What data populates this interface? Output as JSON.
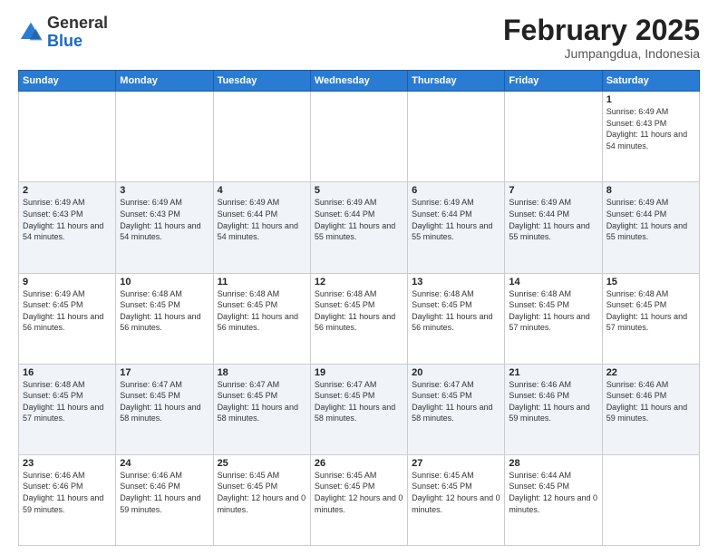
{
  "logo": {
    "general": "General",
    "blue": "Blue"
  },
  "title": {
    "month_year": "February 2025",
    "location": "Jumpangdua, Indonesia"
  },
  "weekdays": [
    "Sunday",
    "Monday",
    "Tuesday",
    "Wednesday",
    "Thursday",
    "Friday",
    "Saturday"
  ],
  "weeks": [
    [
      {
        "day": "",
        "info": ""
      },
      {
        "day": "",
        "info": ""
      },
      {
        "day": "",
        "info": ""
      },
      {
        "day": "",
        "info": ""
      },
      {
        "day": "",
        "info": ""
      },
      {
        "day": "",
        "info": ""
      },
      {
        "day": "1",
        "info": "Sunrise: 6:49 AM\nSunset: 6:43 PM\nDaylight: 11 hours\nand 54 minutes."
      }
    ],
    [
      {
        "day": "2",
        "info": "Sunrise: 6:49 AM\nSunset: 6:43 PM\nDaylight: 11 hours\nand 54 minutes."
      },
      {
        "day": "3",
        "info": "Sunrise: 6:49 AM\nSunset: 6:43 PM\nDaylight: 11 hours\nand 54 minutes."
      },
      {
        "day": "4",
        "info": "Sunrise: 6:49 AM\nSunset: 6:44 PM\nDaylight: 11 hours\nand 54 minutes."
      },
      {
        "day": "5",
        "info": "Sunrise: 6:49 AM\nSunset: 6:44 PM\nDaylight: 11 hours\nand 55 minutes."
      },
      {
        "day": "6",
        "info": "Sunrise: 6:49 AM\nSunset: 6:44 PM\nDaylight: 11 hours\nand 55 minutes."
      },
      {
        "day": "7",
        "info": "Sunrise: 6:49 AM\nSunset: 6:44 PM\nDaylight: 11 hours\nand 55 minutes."
      },
      {
        "day": "8",
        "info": "Sunrise: 6:49 AM\nSunset: 6:44 PM\nDaylight: 11 hours\nand 55 minutes."
      }
    ],
    [
      {
        "day": "9",
        "info": "Sunrise: 6:49 AM\nSunset: 6:45 PM\nDaylight: 11 hours\nand 56 minutes."
      },
      {
        "day": "10",
        "info": "Sunrise: 6:48 AM\nSunset: 6:45 PM\nDaylight: 11 hours\nand 56 minutes."
      },
      {
        "day": "11",
        "info": "Sunrise: 6:48 AM\nSunset: 6:45 PM\nDaylight: 11 hours\nand 56 minutes."
      },
      {
        "day": "12",
        "info": "Sunrise: 6:48 AM\nSunset: 6:45 PM\nDaylight: 11 hours\nand 56 minutes."
      },
      {
        "day": "13",
        "info": "Sunrise: 6:48 AM\nSunset: 6:45 PM\nDaylight: 11 hours\nand 56 minutes."
      },
      {
        "day": "14",
        "info": "Sunrise: 6:48 AM\nSunset: 6:45 PM\nDaylight: 11 hours\nand 57 minutes."
      },
      {
        "day": "15",
        "info": "Sunrise: 6:48 AM\nSunset: 6:45 PM\nDaylight: 11 hours\nand 57 minutes."
      }
    ],
    [
      {
        "day": "16",
        "info": "Sunrise: 6:48 AM\nSunset: 6:45 PM\nDaylight: 11 hours\nand 57 minutes."
      },
      {
        "day": "17",
        "info": "Sunrise: 6:47 AM\nSunset: 6:45 PM\nDaylight: 11 hours\nand 58 minutes."
      },
      {
        "day": "18",
        "info": "Sunrise: 6:47 AM\nSunset: 6:45 PM\nDaylight: 11 hours\nand 58 minutes."
      },
      {
        "day": "19",
        "info": "Sunrise: 6:47 AM\nSunset: 6:45 PM\nDaylight: 11 hours\nand 58 minutes."
      },
      {
        "day": "20",
        "info": "Sunrise: 6:47 AM\nSunset: 6:45 PM\nDaylight: 11 hours\nand 58 minutes."
      },
      {
        "day": "21",
        "info": "Sunrise: 6:46 AM\nSunset: 6:46 PM\nDaylight: 11 hours\nand 59 minutes."
      },
      {
        "day": "22",
        "info": "Sunrise: 6:46 AM\nSunset: 6:46 PM\nDaylight: 11 hours\nand 59 minutes."
      }
    ],
    [
      {
        "day": "23",
        "info": "Sunrise: 6:46 AM\nSunset: 6:46 PM\nDaylight: 11 hours\nand 59 minutes."
      },
      {
        "day": "24",
        "info": "Sunrise: 6:46 AM\nSunset: 6:46 PM\nDaylight: 11 hours\nand 59 minutes."
      },
      {
        "day": "25",
        "info": "Sunrise: 6:45 AM\nSunset: 6:45 PM\nDaylight: 12 hours\nand 0 minutes."
      },
      {
        "day": "26",
        "info": "Sunrise: 6:45 AM\nSunset: 6:45 PM\nDaylight: 12 hours\nand 0 minutes."
      },
      {
        "day": "27",
        "info": "Sunrise: 6:45 AM\nSunset: 6:45 PM\nDaylight: 12 hours\nand 0 minutes."
      },
      {
        "day": "28",
        "info": "Sunrise: 6:44 AM\nSunset: 6:45 PM\nDaylight: 12 hours\nand 0 minutes."
      },
      {
        "day": "",
        "info": ""
      }
    ]
  ]
}
